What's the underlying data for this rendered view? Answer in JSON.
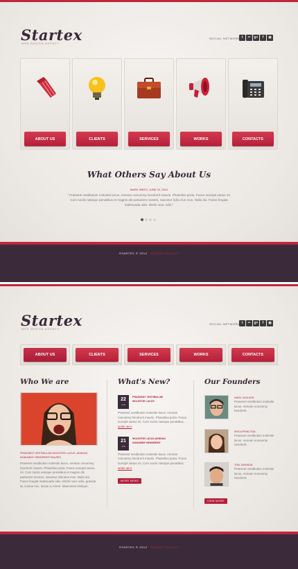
{
  "page1": {
    "logo": "Startex",
    "tagline": "WEB DESIGN AGENCY",
    "social_label": "SOCIAL NETWORK:",
    "social_icons": [
      "twitter-icon",
      "flickr-icon",
      "google-plus-icon",
      "facebook-icon",
      "rss-icon"
    ],
    "social_glyphs": [
      "t",
      "••",
      "g+",
      "f",
      "◉"
    ],
    "cards": [
      {
        "label": "ABOUT US",
        "icon": "tie-icon"
      },
      {
        "label": "CLIENTS",
        "icon": "lightbulb-icon"
      },
      {
        "label": "SERVICES",
        "icon": "briefcase-icon"
      },
      {
        "label": "WORKS",
        "icon": "megaphone-icon"
      },
      {
        "label": "CONTACTS",
        "icon": "telephone-icon"
      }
    ],
    "testimonial": {
      "title": "What Others Say About  Us",
      "author": "MARK SMITH, JUNE 22, 2012",
      "text": "\" Praesent vestibulum molestie lacus. Aenean nonummy hendrerit mauris. Phasellus porta. Fusce suscipit varius mi. Cum sociis natoque penatibus et magnis dis parturient montes, nascetur ridicu-lus mus. Nulla dui. Fusce feugiat malesuada odio. Morbi nunc odio.\""
    },
    "footer": {
      "copyright": "STARTEX © 2012",
      "link": "PRIVACY POLICY"
    }
  },
  "page2": {
    "logo": "Startex",
    "tagline": "WEB DESIGN AGENCY",
    "social_label": "SOCIAL NETWORK:",
    "nav": [
      "ABOUT US",
      "CLIENTS",
      "SERVICES",
      "WORKS",
      "CONTACTS"
    ],
    "who": {
      "title": "Who We are",
      "heading": "PRAESENT VESTIBULUM MOLESTIE LACUS. AENEAN NONUMMY HENDRERIT MAURIS",
      "text": "Praesent vestibulum molestie lacus. Aenean nonummy hendrerit mauris. Phasellus porta. Fusce suscipit varius mi. Cum sociis natoque penatibus et magnis dis parturient montes, nascetur ridiculus mus. Nulla dui. Fusce feugiat malesuada odio. Morbi nunc odio, gravida at, cursus nec, luctus a, lorem. Maecenas tristique."
    },
    "news": {
      "title": "What's New?",
      "items": [
        {
          "day": "22",
          "month": "JUN",
          "heading": "PRAESENT VESTIBULUM MOLESTIE LACUS",
          "text": "Praesent vestibulum molestie lacus. Aenean nonummy hendrerit mauris. Phasellus porta. Fusce suscipit varius mi. Cum sociis natoque penatibus.",
          "more": "MORE INFO"
        },
        {
          "day": "21",
          "month": "JUN",
          "heading": "MOLESTIE LACUS AENEAN NONUMMY HENDRERIT",
          "text": "Praesent vestibulum molestie lacus. Aenean nonummy hendrerit mauris. Phasellus porta. Fusce suscipit varius mi. Cum sociis natoque penatibus.",
          "more": "MORE INFO"
        }
      ],
      "button": "MORE NEWS"
    },
    "founders": {
      "title": "Our Founders",
      "people": [
        {
          "name": "MARK JACKSON",
          "text": "Praesent vestibulum molestie lacus. Aenean nonummy hendrerit."
        },
        {
          "name": "ERICA PRINCTON",
          "text": "Praesent vestibulum molestie lacus. Aenean nonummy hendrerit."
        },
        {
          "name": "TOM JOHNSON",
          "text": "Praesent vestibulum molestie lacus. Aenean nonummy hendrerit."
        }
      ],
      "button": "VIEW MORE"
    },
    "footer": {
      "copyright": "STARTEX © 2012",
      "link": "PRIVACY POLICY"
    }
  }
}
